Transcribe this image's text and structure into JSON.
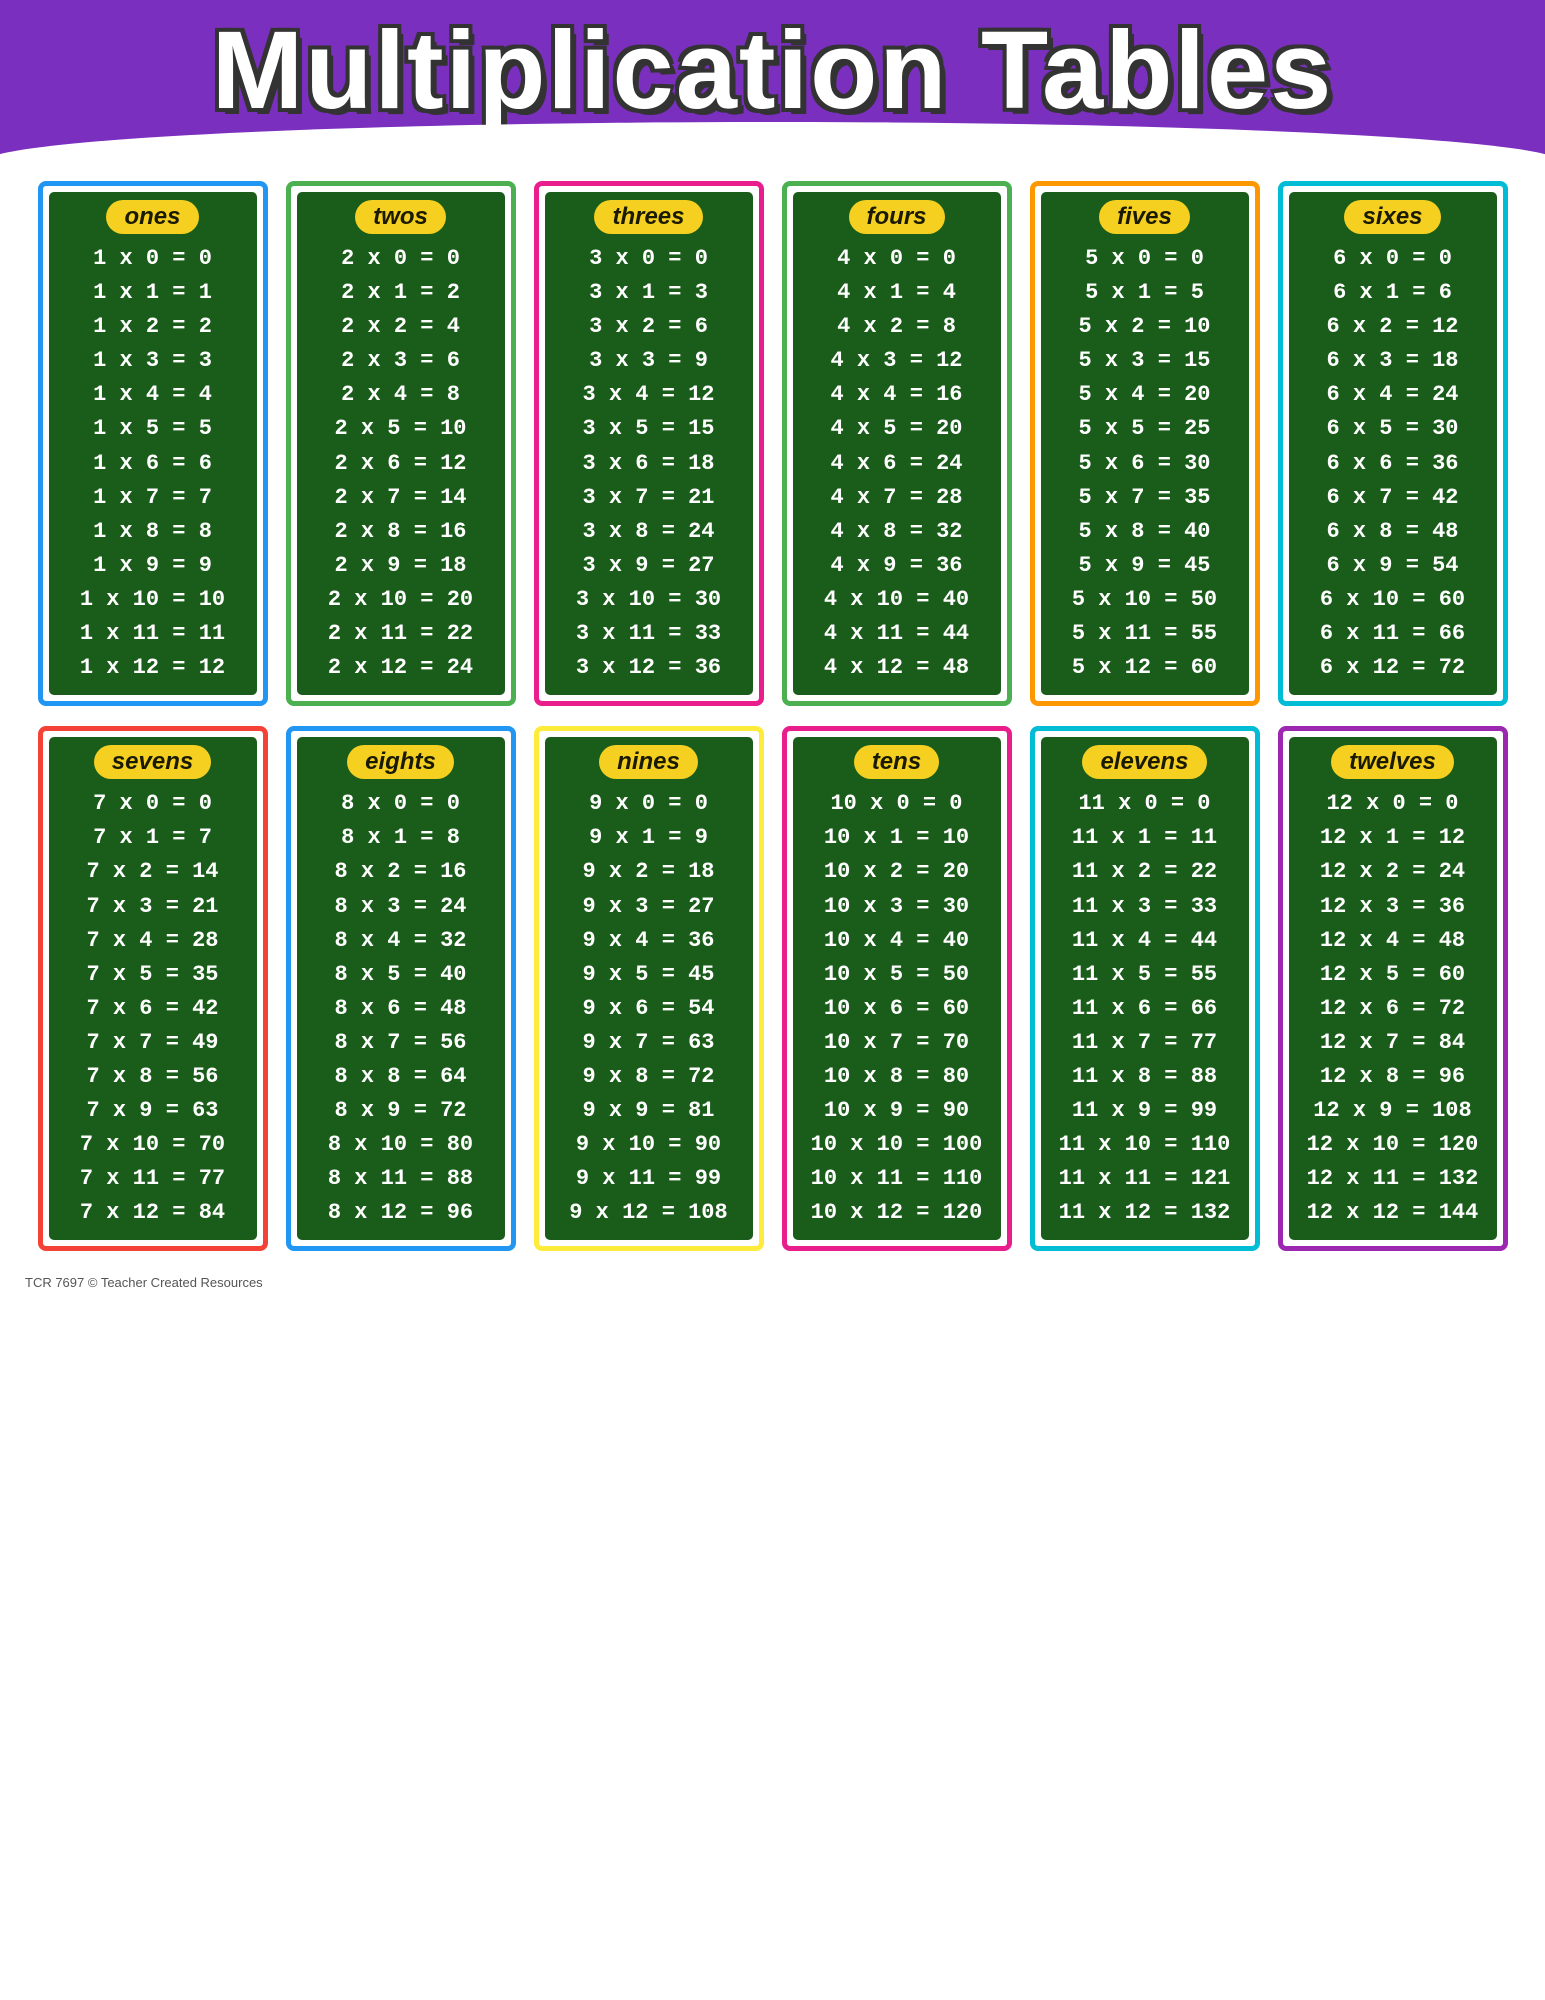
{
  "header": {
    "title": "Multiplication Tables",
    "bg_color": "#7b2fbe"
  },
  "footer": {
    "text": "TCR 7697  © Teacher Created Resources"
  },
  "tables": [
    {
      "id": "ones",
      "label": "ones",
      "border": "border-blue",
      "multiplier": 1,
      "entries": [
        "1 x 0 = 0",
        "1 x 1 = 1",
        "1 x 2 = 2",
        "1 x 3 = 3",
        "1 x 4 = 4",
        "1 x 5 = 5",
        "1 x 6 = 6",
        "1 x 7 = 7",
        "1 x 8 = 8",
        "1 x 9 = 9",
        "1 x 10 = 10",
        "1 x 11 = 11",
        "1 x 12 = 12"
      ]
    },
    {
      "id": "twos",
      "label": "twos",
      "border": "border-green",
      "multiplier": 2,
      "entries": [
        "2 x 0 = 0",
        "2 x 1 = 2",
        "2 x 2 = 4",
        "2 x 3 = 6",
        "2 x 4 = 8",
        "2 x 5 = 10",
        "2 x 6 = 12",
        "2 x 7 = 14",
        "2 x 8 = 16",
        "2 x 9 = 18",
        "2 x 10 = 20",
        "2 x 11 = 22",
        "2 x 12 = 24"
      ]
    },
    {
      "id": "threes",
      "label": "threes",
      "border": "border-pink",
      "multiplier": 3,
      "entries": [
        "3 x 0 = 0",
        "3 x 1 = 3",
        "3 x 2 = 6",
        "3 x 3 = 9",
        "3 x 4 = 12",
        "3 x 5 = 15",
        "3 x 6 = 18",
        "3 x 7 = 21",
        "3 x 8 = 24",
        "3 x 9 = 27",
        "3 x 10 = 30",
        "3 x 11 = 33",
        "3 x 12 = 36"
      ]
    },
    {
      "id": "fours",
      "label": "fours",
      "border": "border-green",
      "multiplier": 4,
      "entries": [
        "4 x 0 = 0",
        "4 x 1 = 4",
        "4 x 2 = 8",
        "4 x 3 = 12",
        "4 x 4 = 16",
        "4 x 5 = 20",
        "4 x 6 = 24",
        "4 x 7 = 28",
        "4 x 8 = 32",
        "4 x 9 = 36",
        "4 x 10 = 40",
        "4 x 11 = 44",
        "4 x 12 = 48"
      ]
    },
    {
      "id": "fives",
      "label": "fives",
      "border": "border-orange",
      "multiplier": 5,
      "entries": [
        "5 x 0 = 0",
        "5 x 1 = 5",
        "5 x 2 = 10",
        "5 x 3 = 15",
        "5 x 4 = 20",
        "5 x 5 = 25",
        "5 x 6 = 30",
        "5 x 7 = 35",
        "5 x 8 = 40",
        "5 x 9 = 45",
        "5 x 10 = 50",
        "5 x 11 = 55",
        "5 x 12 = 60"
      ]
    },
    {
      "id": "sixes",
      "label": "sixes",
      "border": "border-cyan",
      "multiplier": 6,
      "entries": [
        "6 x 0 = 0",
        "6 x 1 = 6",
        "6 x 2 = 12",
        "6 x 3 = 18",
        "6 x 4 = 24",
        "6 x 5 = 30",
        "6 x 6 = 36",
        "6 x 7 = 42",
        "6 x 8 = 48",
        "6 x 9 = 54",
        "6 x 10 = 60",
        "6 x 11 = 66",
        "6 x 12 = 72"
      ]
    },
    {
      "id": "sevens",
      "label": "sevens",
      "border": "border-red",
      "multiplier": 7,
      "entries": [
        "7 x 0 = 0",
        "7 x 1 = 7",
        "7 x 2 = 14",
        "7 x 3 = 21",
        "7 x 4 = 28",
        "7 x 5 = 35",
        "7 x 6 = 42",
        "7 x 7 = 49",
        "7 x 8 = 56",
        "7 x 9 = 63",
        "7 x 10 = 70",
        "7 x 11 = 77",
        "7 x 12 = 84"
      ]
    },
    {
      "id": "eights",
      "label": "eights",
      "border": "border-blue",
      "multiplier": 8,
      "entries": [
        "8 x 0 = 0",
        "8 x 1 = 8",
        "8 x 2 = 16",
        "8 x 3 = 24",
        "8 x 4 = 32",
        "8 x 5 = 40",
        "8 x 6 = 48",
        "8 x 7 = 56",
        "8 x 8 = 64",
        "8 x 9 = 72",
        "8 x 10 = 80",
        "8 x 11 = 88",
        "8 x 12 = 96"
      ]
    },
    {
      "id": "nines",
      "label": "nines",
      "border": "border-yellow",
      "multiplier": 9,
      "entries": [
        "9 x 0 = 0",
        "9 x 1 = 9",
        "9 x 2 = 18",
        "9 x 3 = 27",
        "9 x 4 = 36",
        "9 x 5 = 45",
        "9 x 6 = 54",
        "9 x 7 = 63",
        "9 x 8 = 72",
        "9 x 9 = 81",
        "9 x 10 = 90",
        "9 x 11 = 99",
        "9 x 12 = 108"
      ]
    },
    {
      "id": "tens",
      "label": "tens",
      "border": "border-pink",
      "multiplier": 10,
      "entries": [
        "10 x 0 = 0",
        "10 x 1 = 10",
        "10 x 2 = 20",
        "10 x 3 = 30",
        "10 x 4 = 40",
        "10 x 5 = 50",
        "10 x 6 = 60",
        "10 x 7 = 70",
        "10 x 8 = 80",
        "10 x 9 = 90",
        "10 x 10 = 100",
        "10 x 11 = 110",
        "10 x 12 = 120"
      ]
    },
    {
      "id": "elevens",
      "label": "elevens",
      "border": "border-cyan",
      "multiplier": 11,
      "entries": [
        "11 x 0 = 0",
        "11 x 1 = 11",
        "11 x 2 = 22",
        "11 x 3 = 33",
        "11 x 4 = 44",
        "11 x 5 = 55",
        "11 x 6 = 66",
        "11 x 7 = 77",
        "11 x 8 = 88",
        "11 x 9 = 99",
        "11 x 10 = 110",
        "11 x 11 = 121",
        "11 x 12 = 132"
      ]
    },
    {
      "id": "twelves",
      "label": "twelves",
      "border": "border-purple",
      "multiplier": 12,
      "entries": [
        "12 x 0 = 0",
        "12 x 1 = 12",
        "12 x 2 = 24",
        "12 x 3 = 36",
        "12 x 4 = 48",
        "12 x 5 = 60",
        "12 x 6 = 72",
        "12 x 7 = 84",
        "12 x 8 = 96",
        "12 x 9 = 108",
        "12 x 10 = 120",
        "12 x 11 = 132",
        "12 x 12 = 144"
      ]
    }
  ]
}
